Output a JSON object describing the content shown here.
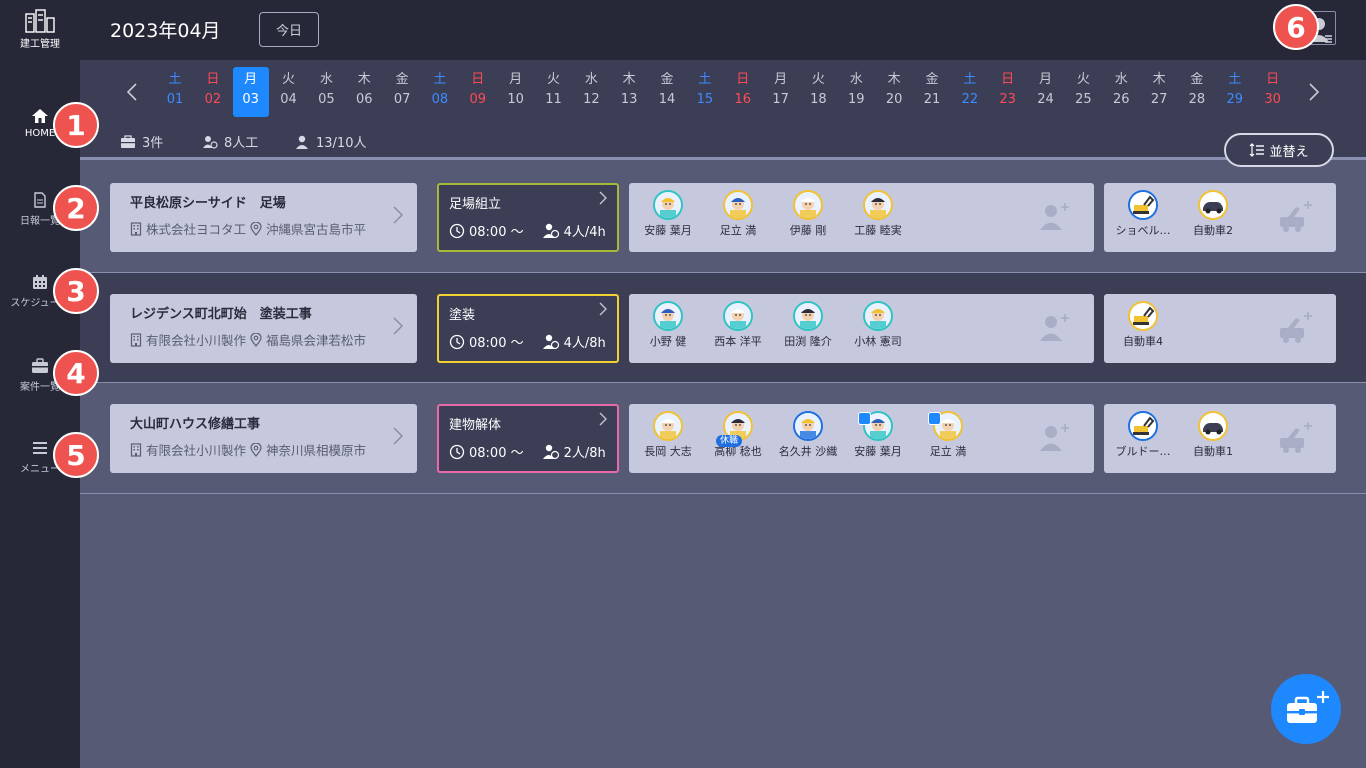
{
  "app": {
    "logo_text": "建工管理",
    "month_title": "2023年04月",
    "today_button": "今日"
  },
  "sidebar": {
    "items": [
      {
        "label": "HOME",
        "icon": "home-icon"
      },
      {
        "label": "日報一覧",
        "icon": "report-icon"
      },
      {
        "label": "スケジュール",
        "icon": "calendar-icon"
      },
      {
        "label": "案件一覧",
        "icon": "briefcase-icon"
      },
      {
        "label": "メニュー",
        "icon": "menu-icon"
      }
    ]
  },
  "badges": [
    "1",
    "2",
    "3",
    "4",
    "5",
    "6"
  ],
  "dates": [
    {
      "dow": "土",
      "day": "01",
      "type": "sat"
    },
    {
      "dow": "日",
      "day": "02",
      "type": "sun"
    },
    {
      "dow": "月",
      "day": "03",
      "type": "selected"
    },
    {
      "dow": "火",
      "day": "04",
      "type": ""
    },
    {
      "dow": "水",
      "day": "05",
      "type": ""
    },
    {
      "dow": "木",
      "day": "06",
      "type": ""
    },
    {
      "dow": "金",
      "day": "07",
      "type": ""
    },
    {
      "dow": "土",
      "day": "08",
      "type": "sat"
    },
    {
      "dow": "日",
      "day": "09",
      "type": "sun"
    },
    {
      "dow": "月",
      "day": "10",
      "type": ""
    },
    {
      "dow": "火",
      "day": "11",
      "type": ""
    },
    {
      "dow": "水",
      "day": "12",
      "type": ""
    },
    {
      "dow": "木",
      "day": "13",
      "type": ""
    },
    {
      "dow": "金",
      "day": "14",
      "type": ""
    },
    {
      "dow": "土",
      "day": "15",
      "type": "sat"
    },
    {
      "dow": "日",
      "day": "16",
      "type": "sun"
    },
    {
      "dow": "月",
      "day": "17",
      "type": ""
    },
    {
      "dow": "火",
      "day": "18",
      "type": ""
    },
    {
      "dow": "水",
      "day": "19",
      "type": ""
    },
    {
      "dow": "木",
      "day": "20",
      "type": ""
    },
    {
      "dow": "金",
      "day": "21",
      "type": ""
    },
    {
      "dow": "土",
      "day": "22",
      "type": "sat"
    },
    {
      "dow": "日",
      "day": "23",
      "type": "sun"
    },
    {
      "dow": "月",
      "day": "24",
      "type": ""
    },
    {
      "dow": "火",
      "day": "25",
      "type": ""
    },
    {
      "dow": "水",
      "day": "26",
      "type": ""
    },
    {
      "dow": "木",
      "day": "27",
      "type": ""
    },
    {
      "dow": "金",
      "day": "28",
      "type": ""
    },
    {
      "dow": "土",
      "day": "29",
      "type": "sat"
    },
    {
      "dow": "日",
      "day": "30",
      "type": "sun"
    }
  ],
  "summary": {
    "projects": "3件",
    "manpower": "8人工",
    "people": "13/10人",
    "sort_button": "並替え"
  },
  "rows": [
    {
      "project_title": "平良松原シーサイド　足場",
      "company": "株式会社ヨコタ工",
      "address": "沖縄県宮古島市平",
      "task": {
        "name": "足場組立",
        "time": "08:00 ～",
        "manpower": "4人/4h",
        "border_color": "#a6b83a"
      },
      "workers": [
        {
          "name": "安藤 葉月",
          "ring": "#2ec4c4",
          "tag": ""
        },
        {
          "name": "足立 満",
          "ring": "#f2c230",
          "tag": ""
        },
        {
          "name": "伊藤 剛",
          "ring": "#f2c230",
          "tag": ""
        },
        {
          "name": "工藤 睦実",
          "ring": "#f2c230",
          "tag": ""
        }
      ],
      "equipment": [
        {
          "name": "ショベル…",
          "ring": "#1e6fe0"
        },
        {
          "name": "自動車2",
          "ring": "#f2c230"
        }
      ]
    },
    {
      "project_title": "レジデンス町北町始　塗装工事",
      "company": "有限会社小川製作",
      "address": "福島県会津若松市",
      "task": {
        "name": "塗装",
        "time": "08:00 ～",
        "manpower": "4人/8h",
        "border_color": "#f2d230"
      },
      "workers": [
        {
          "name": "小野 健",
          "ring": "#2ec4c4",
          "tag": ""
        },
        {
          "name": "西本 洋平",
          "ring": "#2ec4c4",
          "tag": ""
        },
        {
          "name": "田渕 隆介",
          "ring": "#2ec4c4",
          "tag": ""
        },
        {
          "name": "小林 憲司",
          "ring": "#2ec4c4",
          "tag": ""
        }
      ],
      "equipment": [
        {
          "name": "自動車4",
          "ring": "#f2c230"
        }
      ]
    },
    {
      "project_title": "大山町ハウス修繕工事",
      "company": "有限会社小川製作",
      "address": "神奈川県相模原市",
      "task": {
        "name": "建物解体",
        "time": "08:00 ～",
        "manpower": "2人/8h",
        "border_color": "#e86aa8"
      },
      "workers": [
        {
          "name": "長岡 大志",
          "ring": "#f2c230",
          "tag": ""
        },
        {
          "name": "高柳 稔也",
          "ring": "#f2c230",
          "tag": "休職"
        },
        {
          "name": "名久井 沙織",
          "ring": "#1e6fe0",
          "tag": ""
        },
        {
          "name": "安藤 葉月",
          "ring": "#2ec4c4",
          "tag": "mini"
        },
        {
          "name": "足立 満",
          "ring": "#f2c230",
          "tag": "mini"
        }
      ],
      "equipment": [
        {
          "name": "ブルドー…",
          "ring": "#1e6fe0"
        },
        {
          "name": "自動車1",
          "ring": "#f2c230"
        }
      ]
    }
  ]
}
